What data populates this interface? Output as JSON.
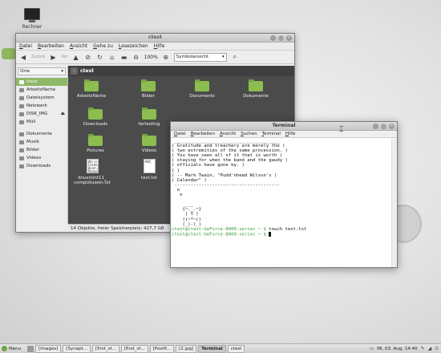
{
  "desktop": {
    "icon_label": "Rechner"
  },
  "file_manager": {
    "title": "ctest",
    "menu": [
      "Datei",
      "Bearbeiten",
      "Ansicht",
      "Gehe zu",
      "Lesezeichen",
      "Hilfe"
    ],
    "toolbar": {
      "back": "Zurück",
      "forward": "Vor",
      "zoom": "100%",
      "view_mode": "Symbolansicht"
    },
    "sidebar": {
      "header": "Orte",
      "items": [
        "ctest",
        "Arbeitsfläche",
        "Dateisystem",
        "Netzwerk",
        "DISK_IMG",
        "Müll"
      ],
      "bookmarks": [
        "Dokumente",
        "Musik",
        "Bilder",
        "Videos",
        "Downloads"
      ]
    },
    "path": "ctest",
    "files": [
      {
        "name": "Arbeitsfläche",
        "kind": "folder"
      },
      {
        "name": "Bilder",
        "kind": "folder"
      },
      {
        "name": "Documents",
        "kind": "folder"
      },
      {
        "name": "Dokumente",
        "kind": "folder"
      },
      {
        "name": "Downloads",
        "kind": "folder"
      },
      {
        "name": "fertesting",
        "kind": "folder"
      },
      {
        "name": "Pictures",
        "kind": "folder"
      },
      {
        "name": "Videos",
        "kind": "folder"
      },
      {
        "name": "linuxmint11_\ncompiztusein.txt",
        "kind": "text",
        "preview": "Wir in\nFrieden\nBeim X\nModule"
      },
      {
        "name": "test.txt",
        "kind": "text",
        "preview": "ABC"
      }
    ],
    "status": "14 Objekte, freier Speicherplatz: 427,7 GB"
  },
  "terminal": {
    "title": "Terminal",
    "menu": [
      "Datei",
      "Bearbeiten",
      "Ansicht",
      "Suchen",
      "Terminal",
      "Hilfe"
    ],
    "output": " _______________________________________\n( Gratitude and treachery are merely the )\n( two extremities of the same procession. )\n( You have seen all of it that is worth )\n( staying for when the band and the gaudy )\n( officials have gone by. )\n( )\n( -- Mark Twain, \"Pudd'nhead Wilson's )\n( Calendar\" )\n ---------------------------------------\n  o\n   o\n\n     ___\n    {~._.~}\n     ( Y )\n    ()~*~()\n    (_)-(_)",
    "prompt1": "ctest@ctest-GeForce-8000-series ~ $",
    "command1": " touch test.txt",
    "prompt2": "ctest@ctest-GeForce-8000-series ~ $"
  },
  "taskbar": {
    "menu_label": "Menu",
    "tasks": [
      "[images]",
      "[Synapt...",
      "[first_st...",
      "[first_st...",
      "[Postfi...",
      "[2.jpg]",
      "Terminal",
      "ctest"
    ],
    "clock": "Mi, 03. Aug, 14:40"
  },
  "colors": {
    "mint_green": "#8cb868",
    "prompt_green": "#3a9c3a",
    "folder_green": "#8bbd4f"
  }
}
